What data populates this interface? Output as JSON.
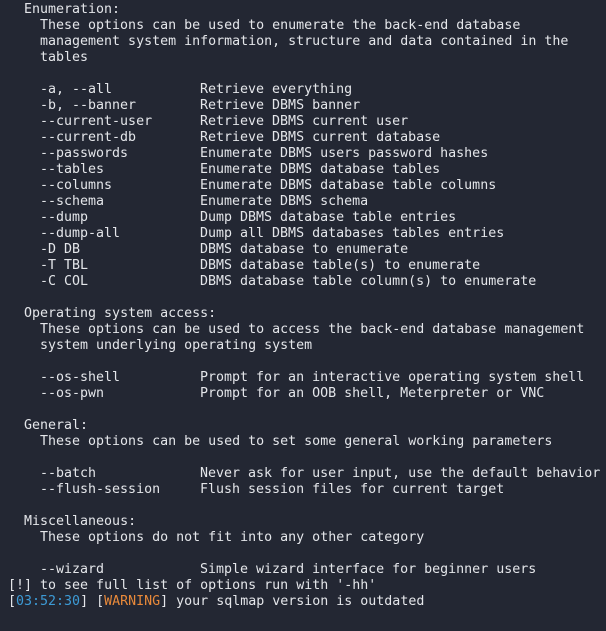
{
  "colors": {
    "background": "#232733",
    "text": "#e4e6ea",
    "timestamp": "#3d9bd6",
    "warning": "#e8893a"
  },
  "sections": [
    {
      "title": "Enumeration:",
      "description": [
        "These options can be used to enumerate the back-end database",
        "management system information, structure and data contained in the",
        "tables"
      ],
      "options": [
        [
          "-a, --all",
          "Retrieve everything"
        ],
        [
          "-b, --banner",
          "Retrieve DBMS banner"
        ],
        [
          "--current-user",
          "Retrieve DBMS current user"
        ],
        [
          "--current-db",
          "Retrieve DBMS current database"
        ],
        [
          "--passwords",
          "Enumerate DBMS users password hashes"
        ],
        [
          "--tables",
          "Enumerate DBMS database tables"
        ],
        [
          "--columns",
          "Enumerate DBMS database table columns"
        ],
        [
          "--schema",
          "Enumerate DBMS schema"
        ],
        [
          "--dump",
          "Dump DBMS database table entries"
        ],
        [
          "--dump-all",
          "Dump all DBMS databases tables entries"
        ],
        [
          "-D DB",
          "DBMS database to enumerate"
        ],
        [
          "-T TBL",
          "DBMS database table(s) to enumerate"
        ],
        [
          "-C COL",
          "DBMS database table column(s) to enumerate"
        ]
      ]
    },
    {
      "title": "Operating system access:",
      "description": [
        "These options can be used to access the back-end database management",
        "system underlying operating system"
      ],
      "options": [
        [
          "--os-shell",
          "Prompt for an interactive operating system shell"
        ],
        [
          "--os-pwn",
          "Prompt for an OOB shell, Meterpreter or VNC"
        ]
      ]
    },
    {
      "title": "General:",
      "description": [
        "These options can be used to set some general working parameters"
      ],
      "options": [
        [
          "--batch",
          "Never ask for user input, use the default behavior"
        ],
        [
          "--flush-session",
          "Flush session files for current target"
        ]
      ]
    },
    {
      "title": "Miscellaneous:",
      "description": [
        "These options do not fit into any other category"
      ],
      "options": [
        [
          "--wizard",
          "Simple wizard interface for beginner users"
        ]
      ]
    }
  ],
  "footer": {
    "hint": "[!] to see full list of options run with '-hh'",
    "timestamp": "03:52:30",
    "level": "WARNING",
    "message": " your sqlmap version is outdated"
  }
}
